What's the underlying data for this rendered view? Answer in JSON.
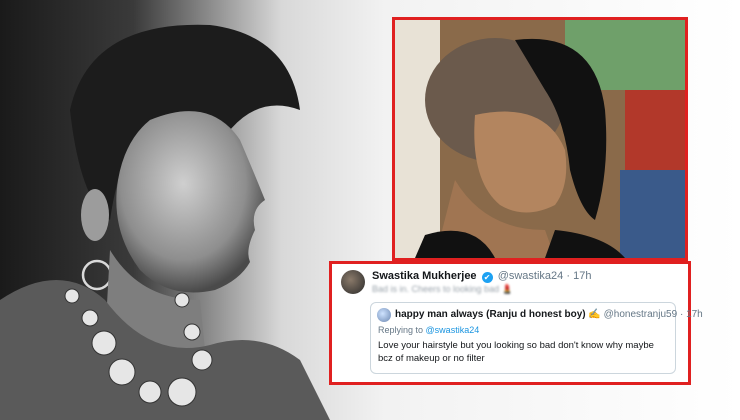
{
  "tweet": {
    "author_name": "Swastika Mukherjee",
    "verified_mark": "✔",
    "author_handle": "@swastika24",
    "separator": "·",
    "time": "17h",
    "text": "Bad is in. Cheers to looking bad 💄"
  },
  "quoted_tweet": {
    "author_name": "happy man always (Ranju d honest boy)",
    "emoji": "✍",
    "author_handle": "@honestranju59",
    "separator": "·",
    "time": "17h",
    "replying_prefix": "Replying to",
    "replying_handle": "@swastika24",
    "text": "Love your hairstyle but you looking so bad don't know why maybe bcz of makeup or no filter"
  },
  "colors": {
    "highlight_border": "#e02020",
    "verified_blue": "#1da1f2",
    "link_blue": "#1b95e0"
  }
}
